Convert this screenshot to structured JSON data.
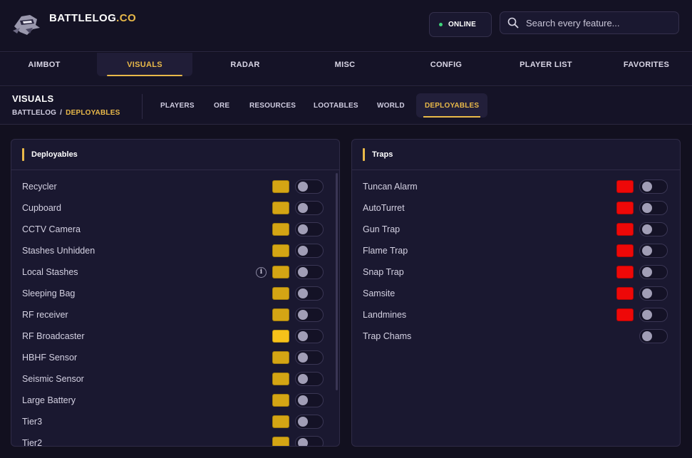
{
  "header": {
    "brand_main": "BATTLELOG",
    "brand_accent": ".CO",
    "status": "ONLINE",
    "search_placeholder": "Search every feature..."
  },
  "main_tabs": [
    "AIMBOT",
    "VISUALS",
    "RADAR",
    "MISC",
    "CONFIG",
    "PLAYER LIST",
    "FAVORITES"
  ],
  "main_tab_active": "VISUALS",
  "section": {
    "title": "VISUALS",
    "breadcrumb_root": "BATTLELOG",
    "breadcrumb_sep": "/",
    "breadcrumb_current": "DEPLOYABLES"
  },
  "sub_tabs": [
    "PLAYERS",
    "ORE",
    "RESOURCES",
    "LOOTABLES",
    "WORLD",
    "DEPLOYABLES"
  ],
  "sub_tab_active": "DEPLOYABLES",
  "colors": {
    "accent": "#e9b949",
    "swatch_gold": "#d4a514",
    "swatch_gold_bright": "#f6c11a",
    "swatch_red": "#ee0808",
    "online_dot": "#3ed67b"
  },
  "deployables": {
    "title": "Deployables",
    "items": [
      {
        "label": "Recycler",
        "swatch": "#d4a514",
        "enabled": false
      },
      {
        "label": "Cupboard",
        "swatch": "#d4a514",
        "enabled": false
      },
      {
        "label": "CCTV Camera",
        "swatch": "#d4a514",
        "enabled": false
      },
      {
        "label": "Stashes Unhidden",
        "swatch": "#d4a514",
        "enabled": false
      },
      {
        "label": "Local Stashes",
        "swatch": "#d4a514",
        "enabled": false,
        "info": "i"
      },
      {
        "label": "Sleeping Bag",
        "swatch": "#d4a514",
        "enabled": false
      },
      {
        "label": "RF receiver",
        "swatch": "#d4a514",
        "enabled": false
      },
      {
        "label": "RF Broadcaster",
        "swatch": "#f6c11a",
        "enabled": false
      },
      {
        "label": "HBHF Sensor",
        "swatch": "#d4a514",
        "enabled": false
      },
      {
        "label": "Seismic Sensor",
        "swatch": "#d4a514",
        "enabled": false
      },
      {
        "label": "Large Battery",
        "swatch": "#d4a514",
        "enabled": false
      },
      {
        "label": "Tier3",
        "swatch": "#d4a514",
        "enabled": false
      },
      {
        "label": "Tier2",
        "swatch": "#d4a514",
        "enabled": false
      }
    ]
  },
  "traps": {
    "title": "Traps",
    "items": [
      {
        "label": "Tuncan Alarm",
        "swatch": "#ee0808",
        "enabled": false
      },
      {
        "label": "AutoTurret",
        "swatch": "#ee0808",
        "enabled": false
      },
      {
        "label": "Gun Trap",
        "swatch": "#ee0808",
        "enabled": false
      },
      {
        "label": "Flame Trap",
        "swatch": "#ee0808",
        "enabled": false
      },
      {
        "label": "Snap Trap",
        "swatch": "#ee0808",
        "enabled": false
      },
      {
        "label": "Samsite",
        "swatch": "#ee0808",
        "enabled": false
      },
      {
        "label": "Landmines",
        "swatch": "#ee0808",
        "enabled": false
      },
      {
        "label": "Trap Chams",
        "swatch": null,
        "enabled": false
      }
    ]
  }
}
